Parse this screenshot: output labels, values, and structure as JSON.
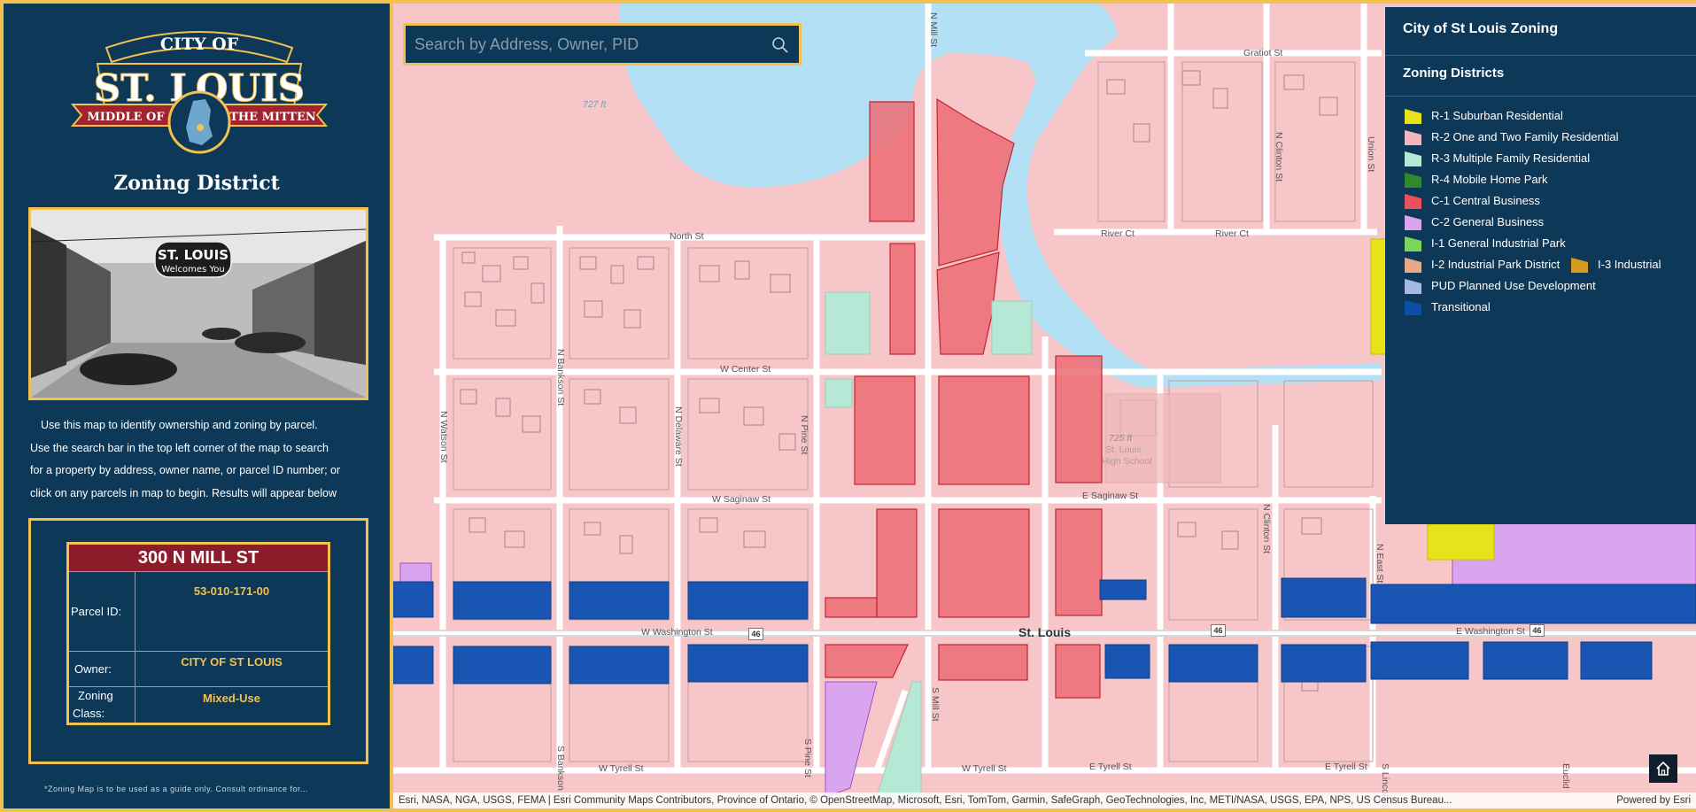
{
  "side": {
    "title": "Zoning District",
    "logo": {
      "line1": "CITY OF",
      "line2": "ST. LOUIS",
      "ribbon_left": "MIDDLE OF",
      "ribbon_right": "THE MITTEN"
    },
    "photo": {
      "sign_line1": "ST. LOUIS",
      "sign_line2": "Welcomes You"
    },
    "description_lines": [
      "Use this map to  identify ownership and zoning by parcel.",
      "Use the search bar in the top left corner of the map to search",
      "for a property by address, owner name, or parcel ID number; or",
      "click on any parcels in map to begin.  Results will appear below"
    ],
    "card": {
      "address": "300 N MILL ST",
      "parcel_label": "Parcel ID:",
      "parcel_value": "53-010-171-00",
      "owner_label": "Owner:",
      "owner_value": "CITY OF ST LOUIS",
      "zoning_label_1": "Zoning",
      "zoning_label_2": "Class:",
      "zoning_value": "Mixed-Use"
    },
    "footnote": "*Zoning Map is to be used as a guide only. Consult ordinance for..."
  },
  "search": {
    "placeholder": "Search by Address, Owner, PID"
  },
  "legend": {
    "title": "City of St Louis Zoning",
    "subtitle": "Zoning Districts",
    "items": [
      {
        "label": "R-1 Suburban Residential",
        "color": "#e8e21a"
      },
      {
        "label": "R-2 One and Two Family Residential",
        "color": "#f2b6bd"
      },
      {
        "label": "R-3 Multiple Family Residential",
        "color": "#b5e8d5"
      },
      {
        "label": "R-4 Mobile Home Park",
        "color": "#2f8a2a"
      },
      {
        "label": "C-1 Central Business",
        "color": "#ec4f5c"
      },
      {
        "label": "C-2 General Business",
        "color": "#d9a5ee"
      },
      {
        "label": "I-1 General Industrial Park",
        "color": "#7ad65a"
      },
      {
        "label": "I-2 Industrial Park District",
        "color": "#e7a98b"
      },
      {
        "label": "I-3 Industrial",
        "color": "#d79a1d"
      },
      {
        "label": "PUD Planned Use Development",
        "color": "#a6b9e0"
      },
      {
        "label": "Transitional",
        "color": "#0c4ea8"
      }
    ]
  },
  "map": {
    "streets": {
      "north": "North St",
      "w_center": "W Center St",
      "w_saginaw": "W Saginaw St",
      "e_saginaw": "E Saginaw St",
      "w_washington": "W Washington St",
      "e_washington": "E Washington St",
      "w_tyrell": "W Tyrell St",
      "w_tyrell2": "W Tyrell St",
      "e_tyrell": "E Tyrell St",
      "e_tyrell2": "E Tyrell St",
      "gratiot": "Gratiot St",
      "river_ct": "River Ct",
      "river_ct2": "River Ct",
      "n_watson": "N Watson St",
      "n_bankson": "N Bankson St",
      "n_delaware": "N Delaware St",
      "n_pine": "N Pine St",
      "n_mill": "N Mill St",
      "n_clinton": "N Clinton St",
      "n_clinton2": "N Clinton St",
      "union": "Union St",
      "n_east": "N East St",
      "s_pine": "S Pine St",
      "s_mill": "S Mill St",
      "s_bankson": "S Bankson St",
      "s_lincoln": "S Lincoln St",
      "euclid": "Euclid"
    },
    "city_label": "St. Louis",
    "route_number": "46",
    "elevation_1": "727 ft",
    "elevation_2": "725 ft",
    "school_label_1": "St. Louis",
    "school_label_2": "High School"
  },
  "attribution": {
    "text": "Esri, NASA, NGA, USGS, FEMA | Esri Community Maps Contributors, Province of Ontario, © OpenStreetMap, Microsoft, Esri, TomTom, Garmin, SafeGraph, GeoTechnologies, Inc, METI/NASA, USGS, EPA, NPS, US Census Bureau...",
    "powered": "Powered by Esri"
  }
}
